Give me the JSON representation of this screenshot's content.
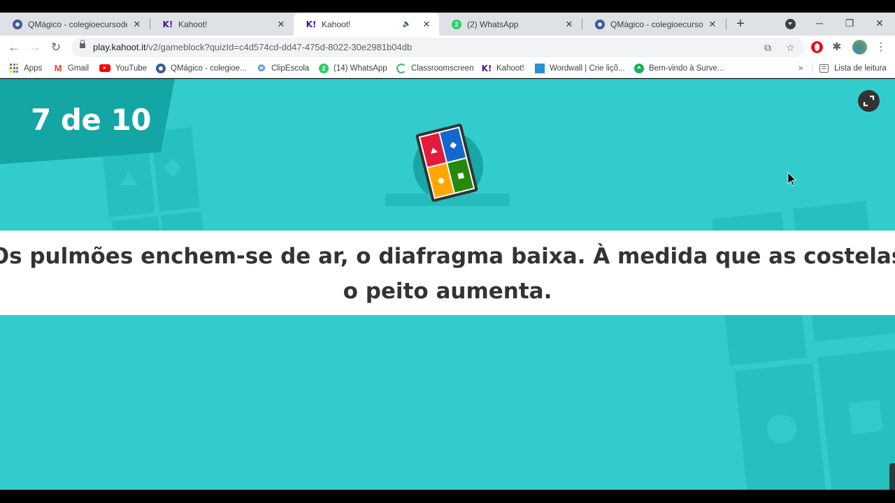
{
  "browser": {
    "tabs": [
      {
        "title": "QMágico - colegioecursodes",
        "favicon": "qmagico-icon",
        "active": false
      },
      {
        "title": "Kahoot!",
        "favicon": "kahoot-icon",
        "active": false
      },
      {
        "title": "Kahoot!",
        "favicon": "kahoot-icon",
        "active": true,
        "audio": true
      },
      {
        "title": "(2) WhatsApp",
        "favicon": "whatsapp-icon",
        "active": false,
        "badge": "2"
      },
      {
        "title": "QMágico - colegioecursodes",
        "favicon": "qmagico-icon",
        "active": false
      }
    ],
    "new_tab_label": "+",
    "url_host": "play.kahoot.it",
    "url_path": "/v2/gameblock?quizId=c4d574cd-dd47-475d-8022-30e2981b04db",
    "bookmarks": [
      {
        "label": "Apps",
        "icon": "apps-grid-icon"
      },
      {
        "label": "Gmail",
        "icon": "gmail-icon"
      },
      {
        "label": "YouTube",
        "icon": "youtube-icon"
      },
      {
        "label": "QMágico - colegioe...",
        "icon": "qmagico-icon"
      },
      {
        "label": "ClipEscola",
        "icon": "clipescola-icon"
      },
      {
        "label": "(14) WhatsApp",
        "icon": "whatsapp-icon",
        "badge": "2"
      },
      {
        "label": "Classroomscreen",
        "icon": "classroomscreen-icon"
      },
      {
        "label": "Kahoot!",
        "icon": "kahoot-icon"
      },
      {
        "label": "Wordwall | Crie liçõ...",
        "icon": "wordwall-icon"
      },
      {
        "label": "Bem-vindo à Surve...",
        "icon": "surveymonkey-icon"
      }
    ],
    "overflow_label": "»",
    "reading_list_label": "Lista de leitura"
  },
  "game": {
    "counter": "7 de 10",
    "question": "Os pulmões enchem-se de ar, o diafragma baixa. À medida que as costelas o peito aumenta.",
    "question_line1": "Os pulmões enchem-se de ar, o diafragma baixa. À medida que as costelas",
    "question_line2": "o peito aumenta.",
    "colors": {
      "background": "#33cccc",
      "banner": "#14a5a5",
      "red": "#e21b3c",
      "blue": "#1368ce",
      "yellow": "#ffa602",
      "green": "#26890c"
    }
  }
}
